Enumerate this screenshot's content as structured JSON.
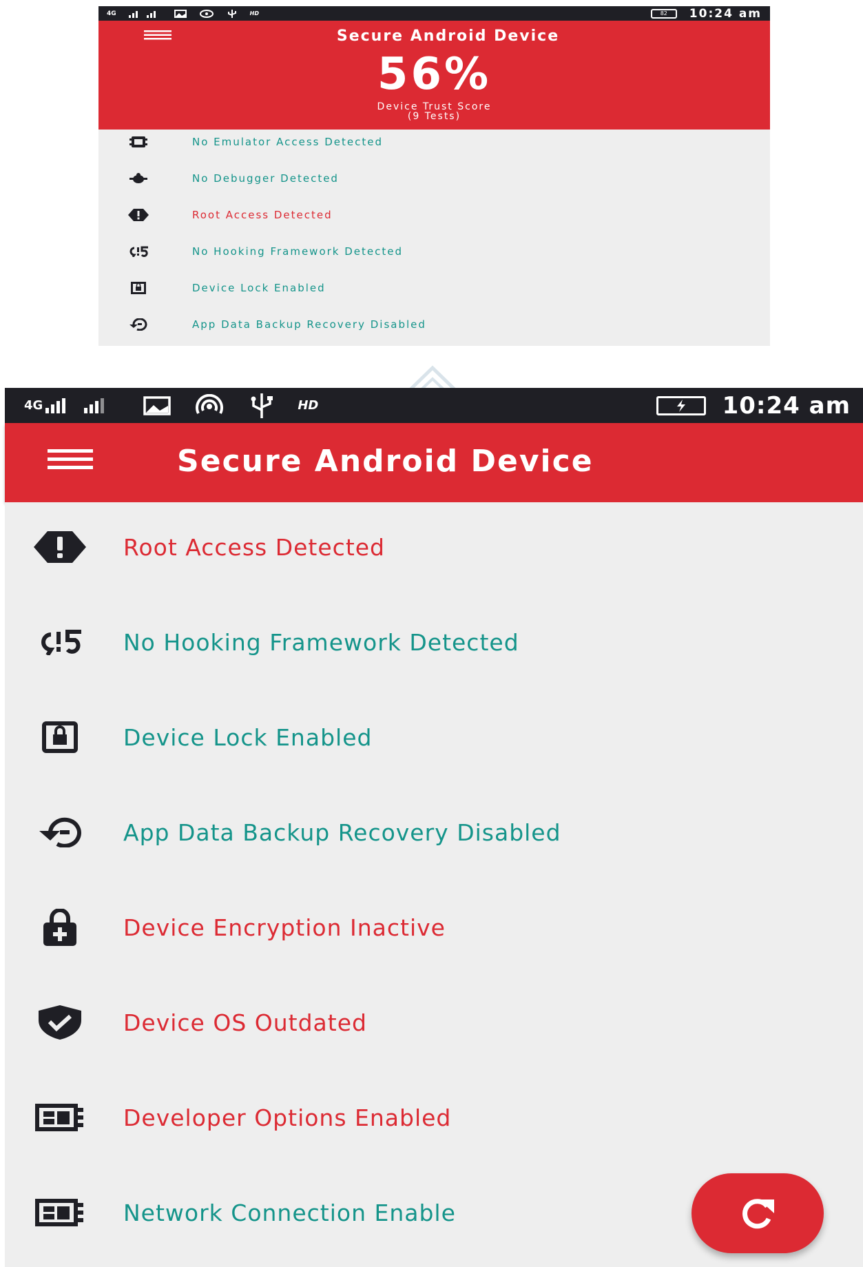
{
  "top": {
    "status": {
      "network": "4G",
      "hd": "HD",
      "battery": "82",
      "time": "10:24 am"
    },
    "title": "Secure Android Device",
    "score": "56%",
    "score_label": "Device Trust Score",
    "tests_label": "(9 Tests)",
    "items": [
      {
        "label": "No Emulator Access Detected",
        "status": "ok",
        "icon": "emulator-icon"
      },
      {
        "label": "No Debugger Detected",
        "status": "ok",
        "icon": "bug-icon"
      },
      {
        "label": "Root Access Detected",
        "status": "bad",
        "icon": "alert-badge-icon"
      },
      {
        "label": "No Hooking Framework Detected",
        "status": "ok",
        "icon": "hook-icon"
      },
      {
        "label": "Device Lock Enabled",
        "status": "ok",
        "icon": "lock-box-icon"
      },
      {
        "label": "App Data Backup Recovery Disabled",
        "status": "ok",
        "icon": "backup-restore-icon"
      }
    ]
  },
  "bottom": {
    "status": {
      "network": "4G",
      "hd": "HD",
      "time": "10:24 am"
    },
    "title": "Secure Android Device",
    "items": [
      {
        "label": "Root Access Detected",
        "status": "bad",
        "icon": "alert-badge-icon"
      },
      {
        "label": "No Hooking Framework Detected",
        "status": "ok",
        "icon": "hook-icon"
      },
      {
        "label": "Device Lock Enabled",
        "status": "ok",
        "icon": "lock-box-icon"
      },
      {
        "label": "App Data Backup Recovery Disabled",
        "status": "ok",
        "icon": "backup-restore-icon"
      },
      {
        "label": "Device Encryption Inactive",
        "status": "bad",
        "icon": "lock-plus-icon"
      },
      {
        "label": "Device OS Outdated",
        "status": "bad",
        "icon": "shield-check-icon"
      },
      {
        "label": "Developer Options Enabled",
        "status": "bad",
        "icon": "developer-board-icon"
      },
      {
        "label": "Network Connection Enable",
        "status": "ok",
        "icon": "developer-board-icon"
      }
    ]
  },
  "colors": {
    "accent": "#dc2a33",
    "ok_text": "#14948a",
    "bad_text": "#dc2a33",
    "statusbar": "#1f1f25",
    "list_bg": "#eeeeee"
  }
}
